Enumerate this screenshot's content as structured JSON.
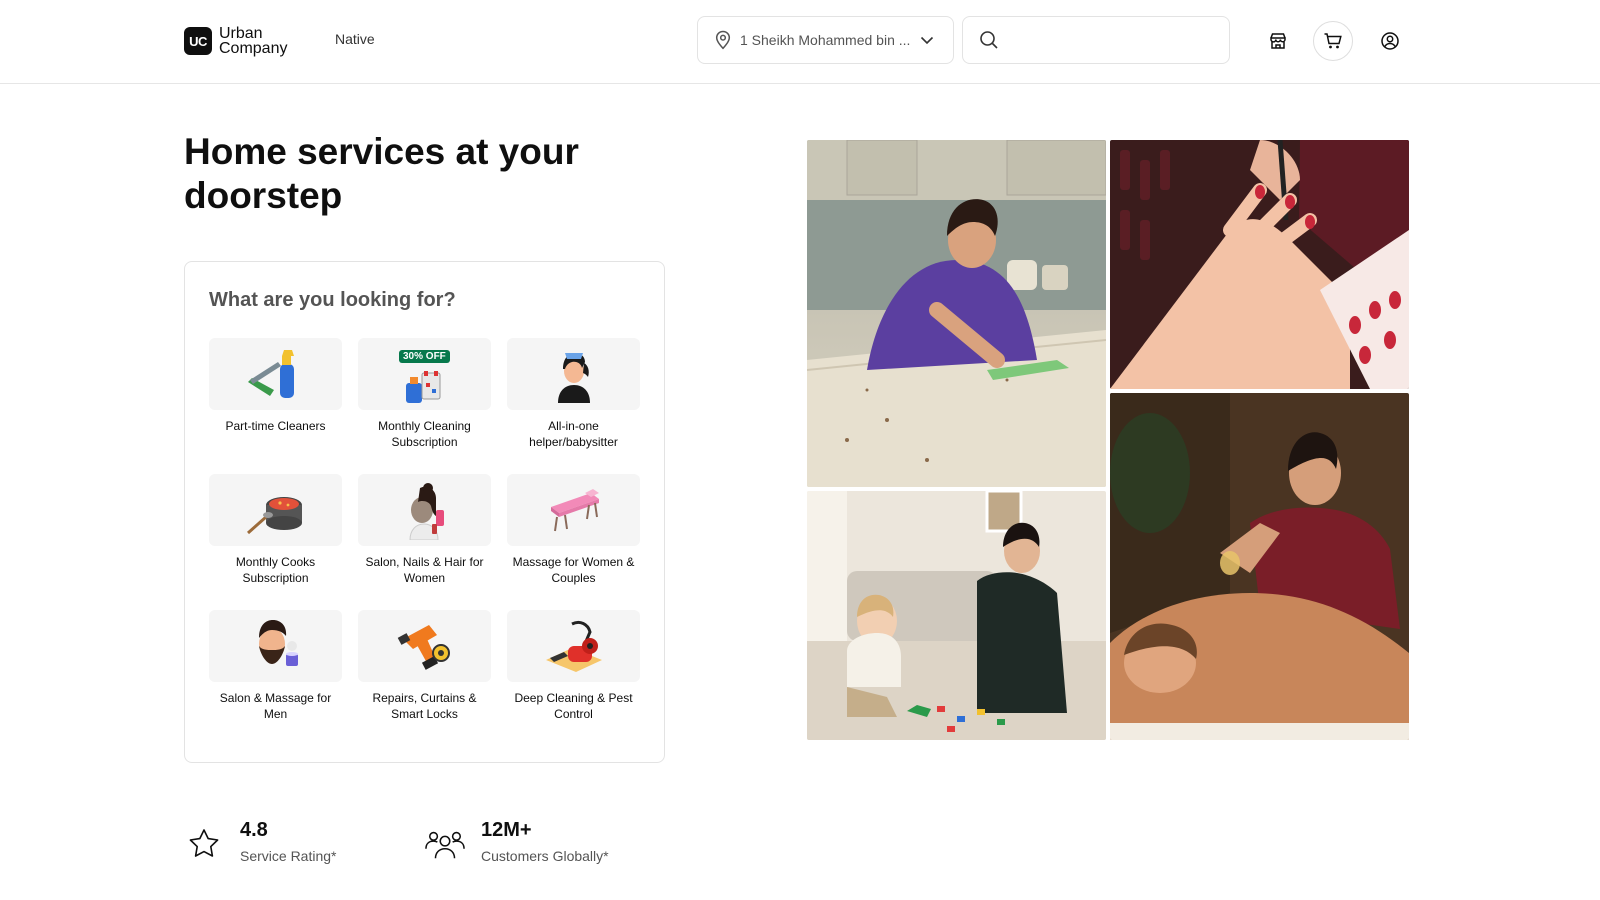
{
  "header": {
    "logo_mark": "UC",
    "logo_line1": "Urban",
    "logo_line2": "Company",
    "native_link": "Native",
    "location_text": "1 Sheikh Mohammed bin ...",
    "search_placeholder": ""
  },
  "hero": {
    "title": "Home services at your doorstep"
  },
  "finder": {
    "title": "What are you looking for?",
    "items": [
      {
        "label": "Part-time Cleaners",
        "icon": "cleaning-spray-icon"
      },
      {
        "label": "Monthly Cleaning Subscription",
        "icon": "cleaning-supplies-icon",
        "badge": "30% OFF"
      },
      {
        "label": "All-in-one helper/babysitter",
        "icon": "helper-icon"
      },
      {
        "label": "Monthly Cooks Subscription",
        "icon": "cooking-pot-icon"
      },
      {
        "label": "Salon, Nails & Hair for Women",
        "icon": "woman-facial-icon"
      },
      {
        "label": "Massage for Women & Couples",
        "icon": "massage-table-icon"
      },
      {
        "label": "Salon & Massage for Men",
        "icon": "bearded-man-icon"
      },
      {
        "label": "Repairs, Curtains & Smart Locks",
        "icon": "drill-icon"
      },
      {
        "label": "Deep Cleaning & Pest Control",
        "icon": "vacuum-icon"
      }
    ]
  },
  "stats": [
    {
      "value": "4.8",
      "caption": "Service Rating*",
      "icon": "star-icon"
    },
    {
      "value": "12M+",
      "caption": "Customers Globally*",
      "icon": "customers-icon"
    }
  ],
  "photos": [
    {
      "name": "cleaner-wiping-counter-photo"
    },
    {
      "name": "manicure-photo"
    },
    {
      "name": "babysitter-playing-photo"
    },
    {
      "name": "massage-therapy-photo"
    }
  ],
  "colors": {
    "accent_green": "#07794c",
    "text_primary": "#0f0f0f",
    "text_secondary": "#545454",
    "border": "#e3e3e3"
  }
}
